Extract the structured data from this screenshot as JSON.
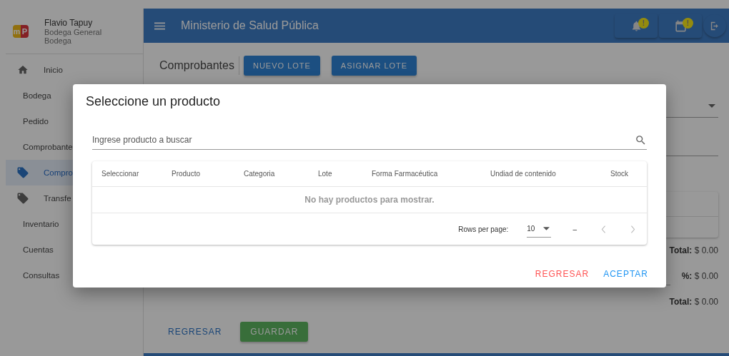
{
  "logo": {
    "left": "m",
    "right": "P"
  },
  "user": {
    "name": "Flavio Tapuy",
    "role": "Bodega General",
    "area": "Bodega"
  },
  "header": {
    "title": "Ministerio de Salud Pública",
    "notifications": [
      {
        "kind": "bell",
        "badge": "!"
      },
      {
        "kind": "calendar",
        "badge": "!"
      }
    ]
  },
  "sidebar": {
    "items": [
      {
        "label": "Inicio",
        "kind": "home",
        "selected": false
      },
      {
        "label": "Bodega",
        "kind": "plain",
        "selected": false
      },
      {
        "label": "Pedido",
        "kind": "plain",
        "selected": false
      },
      {
        "label": "Comprobante",
        "kind": "plain",
        "selected": false
      },
      {
        "label": "Compro",
        "kind": "tag",
        "selected": true
      },
      {
        "label": "Transfe",
        "kind": "tag",
        "selected": false
      },
      {
        "label": "Inventario",
        "kind": "plain",
        "selected": false
      },
      {
        "label": "Cuentas",
        "kind": "plain",
        "selected": false
      },
      {
        "label": "Consultas",
        "kind": "plain",
        "selected": false
      }
    ]
  },
  "page": {
    "title": "Comprobantes",
    "actions": [
      "NUEVO LOTE",
      "ASIGNAR LOTE"
    ],
    "totals": [
      {
        "label": "Total:",
        "value": "$ 0.00",
        "kind": "plain"
      },
      {
        "label": "%:",
        "value": "$ 0.00",
        "kind": "field"
      },
      {
        "label": "Total:",
        "value": "$ 0.00",
        "kind": "plain"
      }
    ],
    "buttons": [
      {
        "label": "REGRESAR",
        "kind": "text"
      },
      {
        "label": "GUARDAR",
        "kind": "filled"
      }
    ]
  },
  "dialog": {
    "title": "Seleccione un producto",
    "search": {
      "placeholder": "Ingrese producto a buscar"
    },
    "table": {
      "columns": [
        "Seleccionar",
        "Producto",
        "Categoria",
        "Lote",
        "Forma Farmacéutica",
        "Undiad de contenido",
        "Stock"
      ],
      "empty_message": "No hay productos para mostrar.",
      "rows_per_page_label": "Rows per page:",
      "rows_per_page": "10",
      "range": "–"
    },
    "buttons": [
      {
        "label": "REGRESAR",
        "kind": "cancel"
      },
      {
        "label": "ACEPTAR",
        "kind": "confirm"
      }
    ]
  }
}
